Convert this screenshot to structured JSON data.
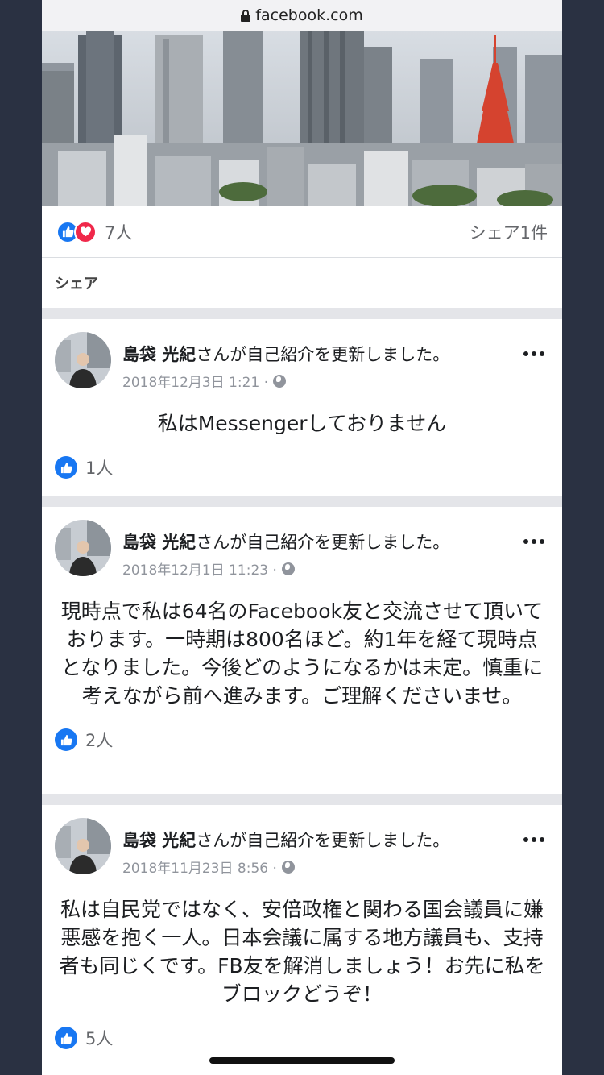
{
  "browser": {
    "url": "facebook.com"
  },
  "top_card": {
    "reaction_count": "7人",
    "share_count": "シェア1件",
    "share_label": "シェア"
  },
  "posts": [
    {
      "author": "島袋 光紀",
      "action": "さんが自己紹介を更新しました。",
      "time": "2018年12月3日 1:21 ·",
      "body": "私はMessengerしておりません",
      "likes": "1人"
    },
    {
      "author": "島袋 光紀",
      "action": "さんが自己紹介を更新しました。",
      "time": "2018年12月1日 11:23 ·",
      "body": "現時点で私は64名のFacebook友と交流させて頂いております。一時期は800名ほど。約1年を経て現時点となりました。今後どのようになるかは未定。慎重に考えながら前へ進みます。ご理解くださいませ。",
      "likes": "2人"
    },
    {
      "author": "島袋 光紀",
      "action": "さんが自己紹介を更新しました。",
      "time": "2018年11月23日 8:56 ·",
      "body": "私は自民党ではなく、安倍政権と関わる国会議員に嫌悪感を抱く一人。日本会議に属する地方議員も、支持者も同じくです。FB友を解消しましょう！お先に私をブロックどうぞ！",
      "likes": "5人"
    }
  ],
  "colors": {
    "facebook_blue": "#1877f2",
    "love_red": "#f0284a",
    "meta_gray": "#90949c"
  }
}
